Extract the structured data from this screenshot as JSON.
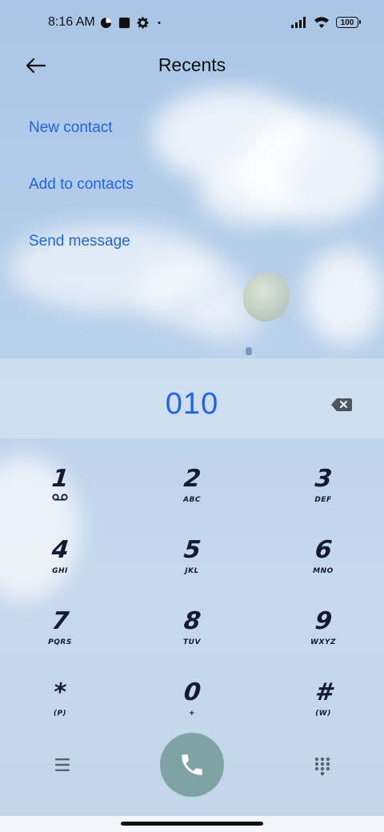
{
  "status_bar": {
    "time": "8:16 AM",
    "icons_left": [
      "data-saver-icon",
      "square-icon",
      "settings-icon",
      "dot-icon"
    ],
    "icons_right": [
      "signal-icon",
      "wifi-icon",
      "battery-icon"
    ],
    "battery": "100"
  },
  "header": {
    "title": "Recents"
  },
  "menu": {
    "items": [
      {
        "label": "New contact"
      },
      {
        "label": "Add to contacts"
      },
      {
        "label": "Send message"
      }
    ]
  },
  "dialer": {
    "number": "010"
  },
  "keypad": {
    "keys": [
      {
        "digit": "1",
        "letters": ""
      },
      {
        "digit": "2",
        "letters": "ABC"
      },
      {
        "digit": "3",
        "letters": "DEF"
      },
      {
        "digit": "4",
        "letters": "GHI"
      },
      {
        "digit": "5",
        "letters": "JKL"
      },
      {
        "digit": "6",
        "letters": "MNO"
      },
      {
        "digit": "7",
        "letters": "PQRS"
      },
      {
        "digit": "8",
        "letters": "TUV"
      },
      {
        "digit": "9",
        "letters": "WXYZ"
      },
      {
        "digit": "*",
        "letters": "(P)"
      },
      {
        "digit": "0",
        "letters": "+"
      },
      {
        "digit": "#",
        "letters": "(W)"
      }
    ]
  },
  "colors": {
    "accent": "#1f64f0",
    "call_button": "#7fa3a2",
    "key_text": "#141a33"
  }
}
